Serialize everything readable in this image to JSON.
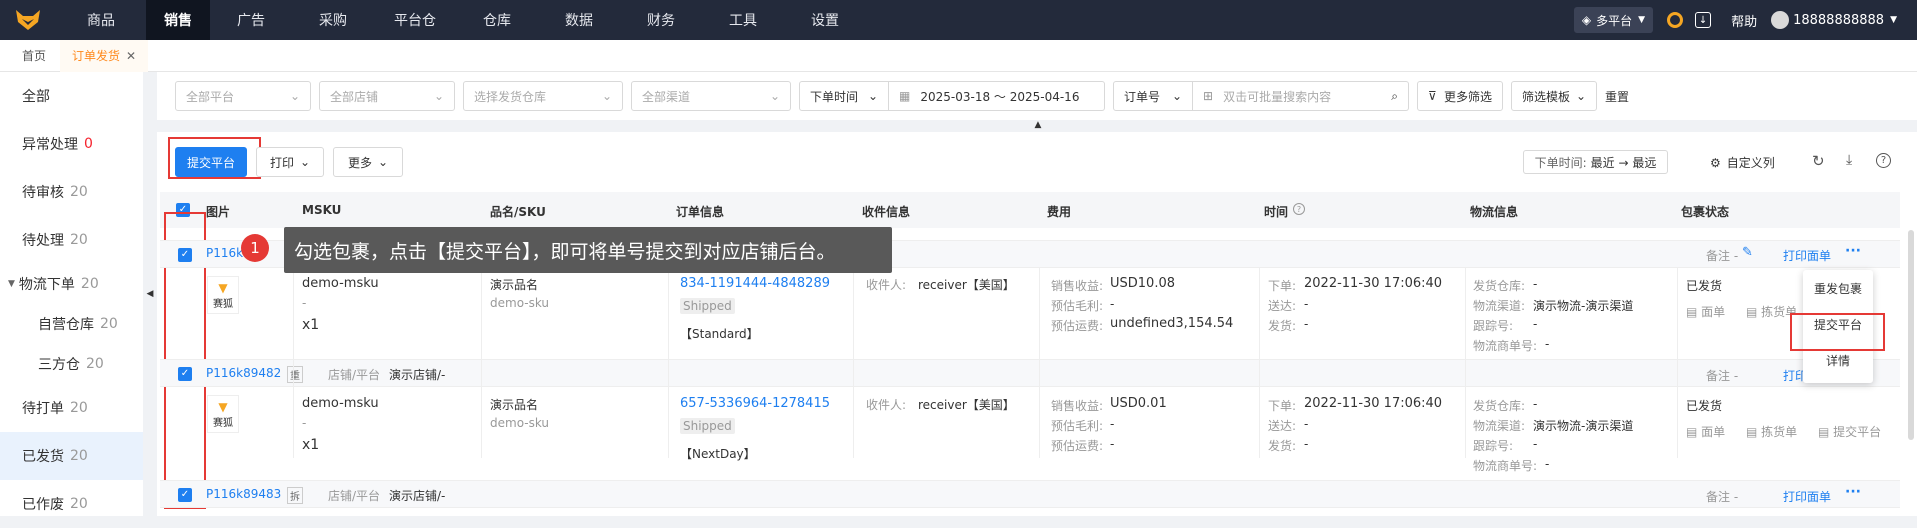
{
  "topnav": {
    "items": [
      "商品",
      "销售",
      "广告",
      "采购",
      "平台仓",
      "仓库",
      "数据",
      "财务",
      "工具",
      "设置"
    ],
    "platform": "多平台",
    "help": "帮助",
    "user": "18888888888"
  },
  "tabs": [
    {
      "label": "首页"
    },
    {
      "label": "订单发货"
    }
  ],
  "sidebar": [
    {
      "label": "全部",
      "count": ""
    },
    {
      "label": "异常处理",
      "count": "0"
    },
    {
      "label": "待审核",
      "count": "20"
    },
    {
      "label": "待处理",
      "count": "20"
    },
    {
      "label": "物流下单",
      "count": "20"
    },
    {
      "label": "自营仓库",
      "count": "20"
    },
    {
      "label": "三方仓",
      "count": "20"
    },
    {
      "label": "待打单",
      "count": "20"
    },
    {
      "label": "已发货",
      "count": "20"
    },
    {
      "label": "已作废",
      "count": "20"
    }
  ],
  "filters": {
    "platform": "全部平台",
    "shop": "全部店铺",
    "warehouse": "选择发货仓库",
    "channel": "全部渠道",
    "time_type": "下单时间",
    "date_range": "2025-03-18 ～ 2025-04-16",
    "order_field": "订单号",
    "search_placeholder": "双击可批量搜索内容",
    "more_filter": "更多筛选",
    "template": "筛选模板",
    "reset": "重置"
  },
  "toolbar": {
    "submit": "提交平台",
    "print": "打印",
    "more": "更多",
    "sort_label": "下单时间:",
    "sort_value": "最近 → 最远",
    "custom_cols": "自定义列"
  },
  "columns": [
    "图片",
    "MSKU",
    "品名/SKU",
    "订单信息",
    "收件信息",
    "费用",
    "时间",
    "物流信息",
    "包裹状态"
  ],
  "tooltip": {
    "num": "1",
    "text": "勾选包裹，点击【提交平台】，即可将单号提交到对应店铺后台。"
  },
  "orders": [
    {
      "id": "P116k8",
      "tag": "",
      "shop_label": "店铺/平台",
      "shop": "演示店铺/-",
      "remark": "备注 -",
      "print": "打印面单",
      "thumb": "赛狐",
      "msku": "demo-msku",
      "msku_sub": "-",
      "qty": "x1",
      "name": "演示品名",
      "sku": "demo-sku",
      "order_no": "834-1191444-4848289",
      "status_badge": "Shipped",
      "ship_type": "【Standard】",
      "receiver_label": "收件人:",
      "receiver": "receiver【美国】",
      "fee1_label": "销售收益:",
      "fee1": "USD10.08",
      "fee2_label": "预估毛利:",
      "fee2": "-",
      "fee3_label": "预估运费:",
      "fee3": "undefined3,154.54",
      "t1_label": "下单:",
      "t1": "2022-11-30 17:06:40",
      "t2_label": "送达:",
      "t2": "-",
      "t3_label": "发货:",
      "t3": "-",
      "l1_label": "发货仓库:",
      "l1": "-",
      "l2_label": "物流渠道:",
      "l2": "演示物流-演示渠道",
      "l3_label": "跟踪号:",
      "l3": "-",
      "l4_label": "物流商单号:",
      "l4": "-",
      "pkg_status": "已发货",
      "act1": "面单",
      "act2": "拣货单"
    },
    {
      "id": "P116k89482",
      "tag": "重",
      "shop_label": "店铺/平台",
      "shop": "演示店铺/-",
      "remark": "备注 -",
      "print": "打印",
      "thumb": "赛狐",
      "msku": "demo-msku",
      "msku_sub": "-",
      "qty": "x1",
      "name": "演示品名",
      "sku": "demo-sku",
      "order_no": "657-5336964-1278415",
      "status_badge": "Shipped",
      "ship_type": "【NextDay】",
      "receiver_label": "收件人:",
      "receiver": "receiver【美国】",
      "fee1_label": "销售收益:",
      "fee1": "USD0.01",
      "fee2_label": "预估毛利:",
      "fee2": "-",
      "fee3_label": "预估运费:",
      "fee3": "-",
      "t1_label": "下单:",
      "t1": "2022-11-30 17:06:40",
      "t2_label": "送达:",
      "t2": "-",
      "t3_label": "发货:",
      "t3": "-",
      "l1_label": "发货仓库:",
      "l1": "-",
      "l2_label": "物流渠道:",
      "l2": "演示物流-演示渠道",
      "l3_label": "跟踪号:",
      "l3": "-",
      "l4_label": "物流商单号:",
      "l4": "-",
      "pkg_status": "已发货",
      "act1": "面单",
      "act2": "拣货单",
      "act3": "提交平台"
    },
    {
      "id": "P116k89483",
      "tag": "拆",
      "shop_label": "店铺/平台",
      "shop": "演示店铺/-",
      "remark": "备注 -",
      "print": "打印面单"
    }
  ],
  "dropdown": [
    "重发包裹",
    "提交平台",
    "详情"
  ],
  "colors": {
    "nav_bg": "#232a3b",
    "accent": "#1e7ff0",
    "highlight": "#e53935",
    "tab_active": "#ff8a1e"
  }
}
